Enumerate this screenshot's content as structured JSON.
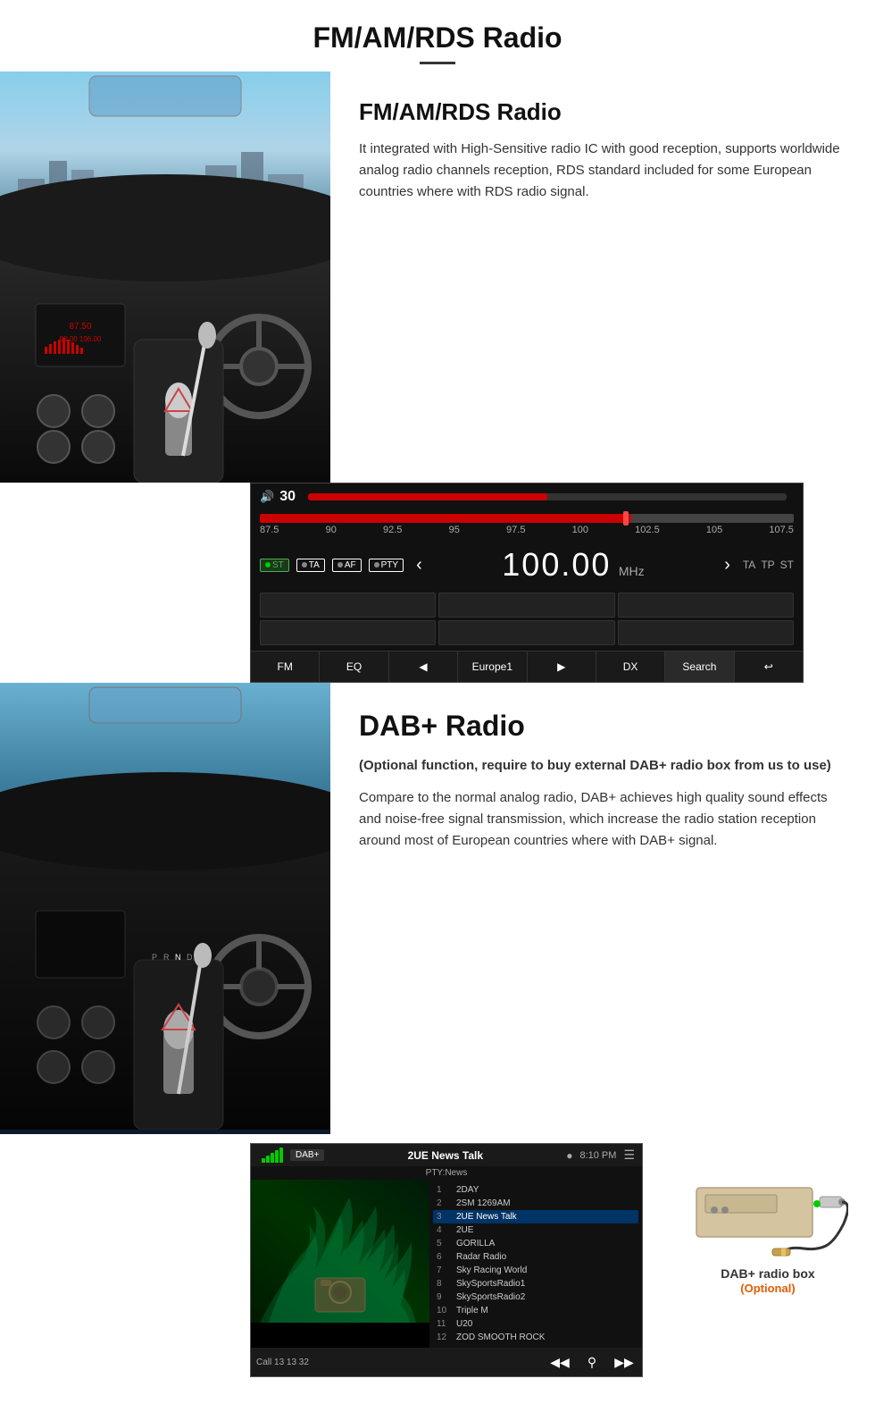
{
  "page": {
    "title": "FM/AM/RDS Radio",
    "title_divider": true
  },
  "fm_section": {
    "heading": "FM/AM/RDS Radio",
    "description": "It integrated with High-Sensitive radio IC with good reception, supports worldwide analog radio channels reception, RDS standard included for some European countries where with RDS radio signal."
  },
  "radio_ui": {
    "volume": "30",
    "volume_icon": "🔊",
    "freq_labels": [
      "87.5",
      "90",
      "92.5",
      "95",
      "97.5",
      "100",
      "102.5",
      "105",
      "107.5"
    ],
    "freq_value": "100.00",
    "freq_unit": "MHz",
    "badges": [
      "ST",
      "TA",
      "AF",
      "PTY"
    ],
    "right_badges": [
      "TA",
      "TP",
      "ST"
    ],
    "toolbar_buttons": [
      "FM",
      "EQ",
      "⏮",
      "Europe1",
      "⏭",
      "DX",
      "Search",
      "↩"
    ]
  },
  "dab_section": {
    "heading": "DAB+ Radio",
    "optional_note": "(Optional function, require to buy external DAB+ radio box from us to use)",
    "description": "Compare to the normal analog radio, DAB+ achieves high quality sound effects and noise-free signal transmission, which increase the radio station reception around most of European countries where with DAB+ signal."
  },
  "dab_ui": {
    "label": "DAB+",
    "station": "2UE News Talk",
    "pty": "PTY:News",
    "time": "8:10 PM",
    "call": "Call 13 13 32",
    "stations": [
      {
        "num": "1",
        "name": "2DAY"
      },
      {
        "num": "2",
        "name": "2SM 1269AM"
      },
      {
        "num": "3",
        "name": "2UE News Talk",
        "active": true
      },
      {
        "num": "4",
        "name": "2UE"
      },
      {
        "num": "5",
        "name": "GORILLA"
      },
      {
        "num": "6",
        "name": "Radar Radio"
      },
      {
        "num": "7",
        "name": "Sky Racing World"
      },
      {
        "num": "8",
        "name": "SkySportsRadio1"
      },
      {
        "num": "9",
        "name": "SkySportsRadio2"
      },
      {
        "num": "10",
        "name": "Triple M"
      },
      {
        "num": "11",
        "name": "U20"
      },
      {
        "num": "12",
        "name": "ZOD SMOOTH ROCK"
      }
    ]
  },
  "dab_box": {
    "label": "DAB+ radio box",
    "optional": "(Optional)"
  }
}
